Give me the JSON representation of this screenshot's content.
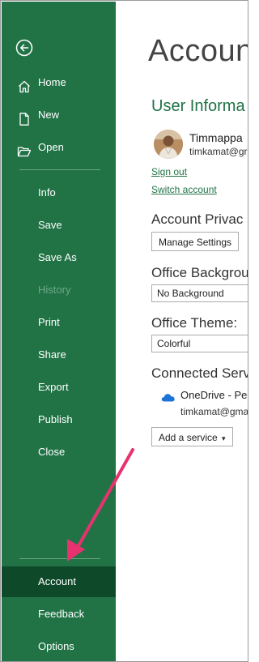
{
  "sidebar": {
    "bg_color": "#217346",
    "selected_color": "#0e4a2a",
    "items_top": [
      {
        "label": "Home",
        "icon": "home-icon"
      },
      {
        "label": "New",
        "icon": "new-document-icon"
      },
      {
        "label": "Open",
        "icon": "open-folder-icon"
      }
    ],
    "items_middle": [
      {
        "label": "Info"
      },
      {
        "label": "Save"
      },
      {
        "label": "Save As"
      },
      {
        "label": "History",
        "disabled": true
      },
      {
        "label": "Print"
      },
      {
        "label": "Share"
      },
      {
        "label": "Export"
      },
      {
        "label": "Publish"
      },
      {
        "label": "Close"
      }
    ],
    "items_bottom": [
      {
        "label": "Account",
        "selected": true
      },
      {
        "label": "Feedback"
      },
      {
        "label": "Options"
      }
    ]
  },
  "main": {
    "title": "Account",
    "user_info": {
      "heading": "User Informa",
      "name": "Timmappa",
      "email": "timkamat@gr",
      "sign_out": "Sign out",
      "switch_account": "Switch account"
    },
    "privacy": {
      "heading": "Account Privac",
      "button": "Manage Settings"
    },
    "background": {
      "heading": "Office Backgrou",
      "value": "No Background"
    },
    "theme": {
      "heading": "Office Theme:",
      "value": "Colorful"
    },
    "services": {
      "heading": "Connected Serv",
      "service_name": "OneDrive - Pe",
      "service_email": "timkamat@gma",
      "add_button": "Add a service",
      "add_caret": "▾"
    }
  },
  "annotation": {
    "arrow_color": "#e8326f"
  }
}
